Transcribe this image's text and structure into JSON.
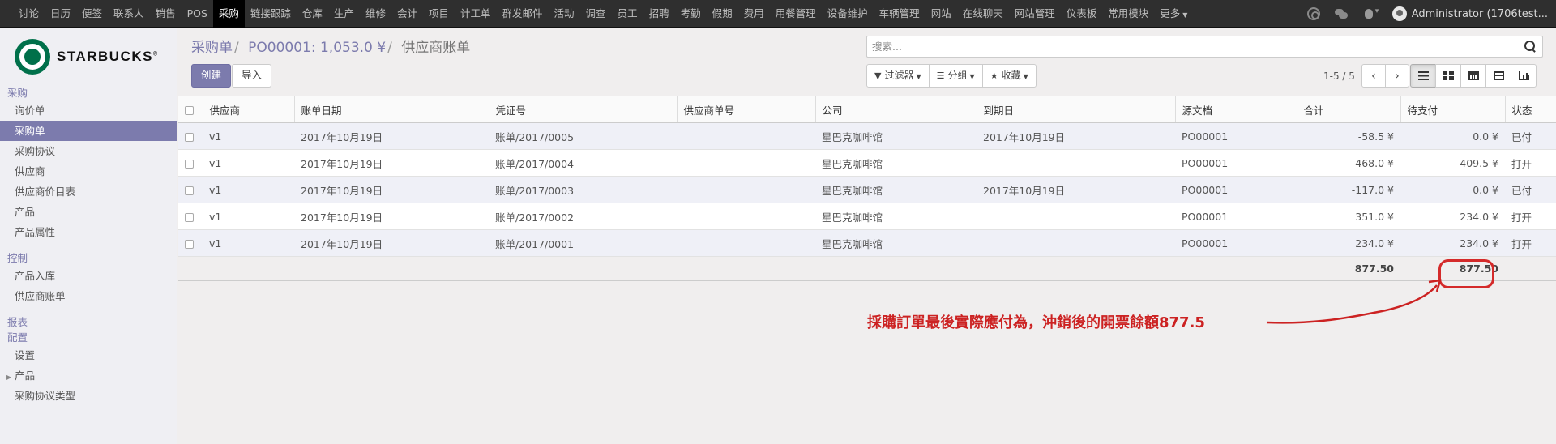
{
  "topnav": {
    "items": [
      "讨论",
      "日历",
      "便签",
      "联系人",
      "销售",
      "POS",
      "采购",
      "链接跟踪",
      "仓库",
      "生产",
      "维修",
      "会计",
      "项目",
      "计工单",
      "群发邮件",
      "活动",
      "调查",
      "员工",
      "招聘",
      "考勤",
      "假期",
      "费用",
      "用餐管理",
      "设备维护",
      "车辆管理",
      "网站",
      "在线聊天",
      "网站管理",
      "仪表板",
      "常用模块",
      "更多"
    ],
    "active": "采购",
    "user": "Administrator (1706test..."
  },
  "brand": {
    "name": "STARBUCKS"
  },
  "sidebar": {
    "purchase_section": "采购",
    "purchase_items": [
      "询价单",
      "采购单",
      "采购协议",
      "供应商",
      "供应商价目表",
      "产品",
      "产品属性"
    ],
    "active_item": "采购单",
    "control_section": "控制",
    "control_items": [
      "产品入库",
      "供应商账单"
    ],
    "report_section": "报表",
    "config_section": "配置",
    "config_items": [
      "设置",
      "产品",
      "采购协议类型"
    ]
  },
  "breadcrumb": {
    "level1": "采购单",
    "level2": "PO00001: 1,053.0 ¥",
    "current": "供应商账单"
  },
  "buttons": {
    "create": "创建",
    "import": "导入"
  },
  "search": {
    "placeholder": "搜索..."
  },
  "filters": {
    "filter": "过滤器",
    "group": "分组",
    "favorites": "收藏"
  },
  "pager": {
    "value": "1-5 / 5"
  },
  "table": {
    "columns": [
      "供应商",
      "账单日期",
      "凭证号",
      "供应商单号",
      "公司",
      "到期日",
      "源文档",
      "合计",
      "待支付",
      "状态"
    ],
    "rows": [
      {
        "vendor": "v1",
        "date": "2017年10月19日",
        "number": "账单/2017/0005",
        "ref": "",
        "company": "星巴克咖啡馆",
        "due": "2017年10月19日",
        "origin": "PO00001",
        "total": "-58.5 ¥",
        "residual": "0.0 ¥",
        "state": "已付"
      },
      {
        "vendor": "v1",
        "date": "2017年10月19日",
        "number": "账单/2017/0004",
        "ref": "",
        "company": "星巴克咖啡馆",
        "due": "",
        "origin": "PO00001",
        "total": "468.0 ¥",
        "residual": "409.5 ¥",
        "state": "打开"
      },
      {
        "vendor": "v1",
        "date": "2017年10月19日",
        "number": "账单/2017/0003",
        "ref": "",
        "company": "星巴克咖啡馆",
        "due": "2017年10月19日",
        "origin": "PO00001",
        "total": "-117.0 ¥",
        "residual": "0.0 ¥",
        "state": "已付"
      },
      {
        "vendor": "v1",
        "date": "2017年10月19日",
        "number": "账单/2017/0002",
        "ref": "",
        "company": "星巴克咖啡馆",
        "due": "",
        "origin": "PO00001",
        "total": "351.0 ¥",
        "residual": "234.0 ¥",
        "state": "打开"
      },
      {
        "vendor": "v1",
        "date": "2017年10月19日",
        "number": "账单/2017/0001",
        "ref": "",
        "company": "星巴克咖啡馆",
        "due": "",
        "origin": "PO00001",
        "total": "234.0 ¥",
        "residual": "234.0 ¥",
        "state": "打开"
      }
    ],
    "footer": {
      "total": "877.50",
      "residual": "877.50"
    }
  },
  "annotation": {
    "text": "採購訂單最後實際應付為，沖銷後的開票餘額877.5",
    "color": "#cc2222"
  },
  "colors": {
    "accent": "#7c7bad",
    "topbar": "#2f2f2f",
    "annotation": "#d42a2a"
  }
}
